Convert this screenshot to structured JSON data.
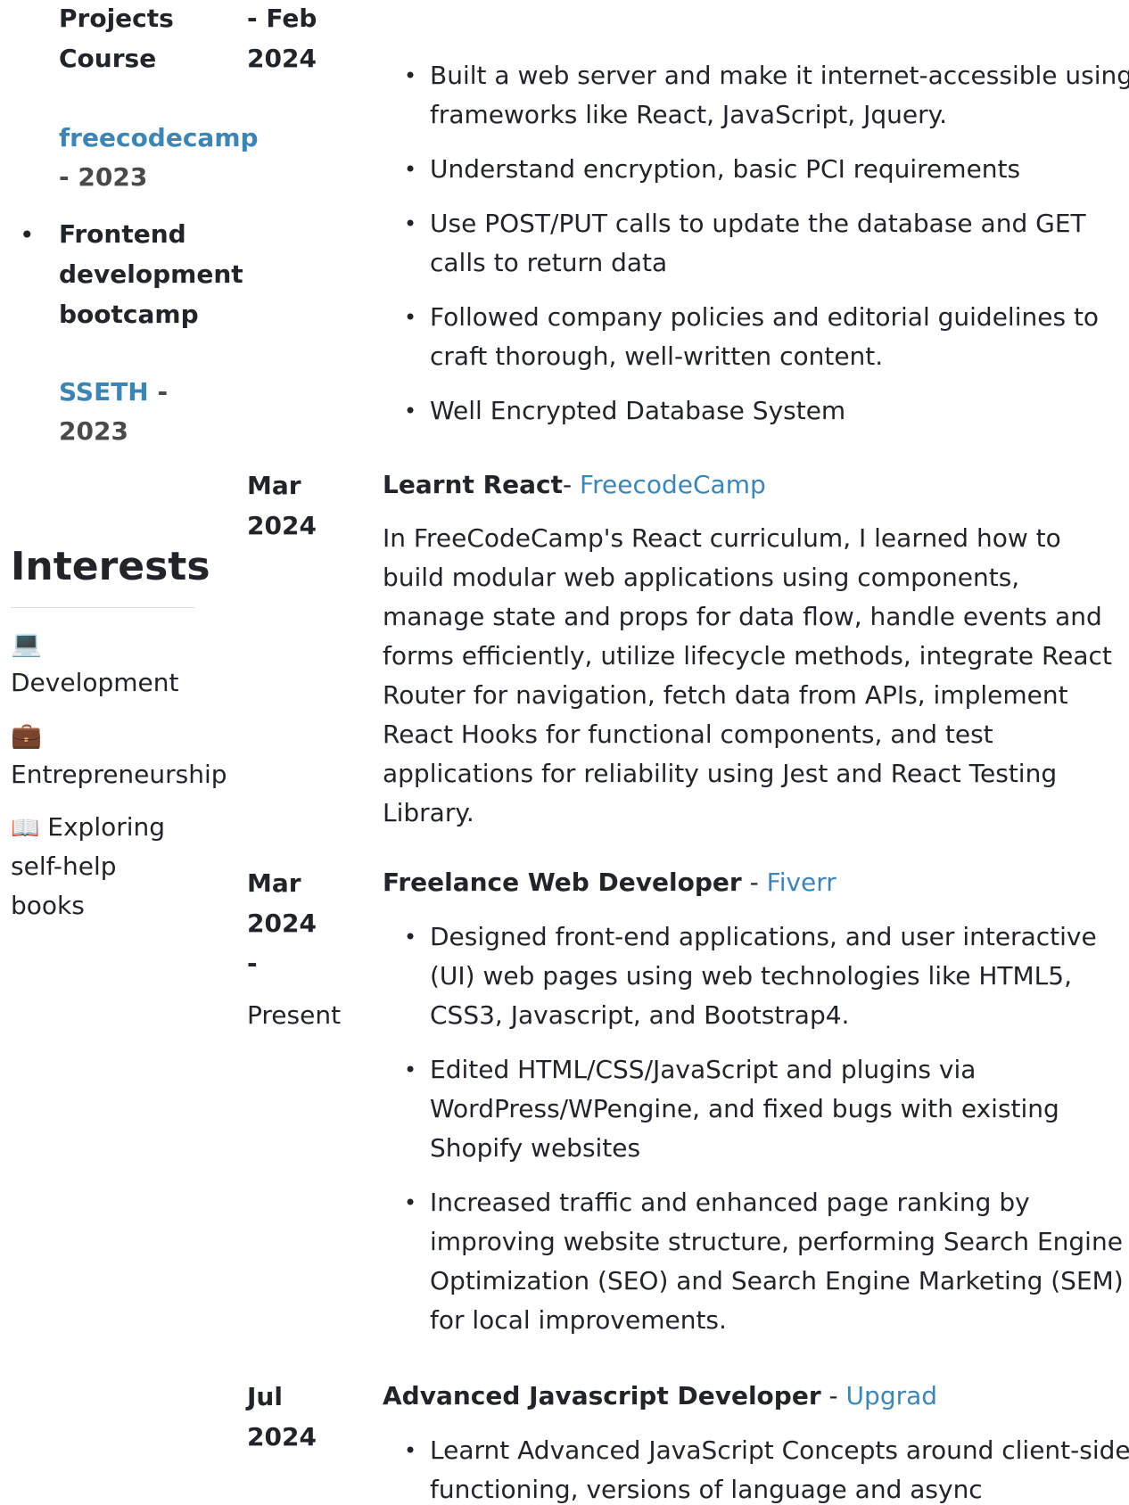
{
  "left": {
    "cert_top": {
      "title_lines": [
        "Projects",
        "Course"
      ]
    },
    "cert_1": {
      "source": "freecodecamp",
      "suffix": "- 2023"
    },
    "cert_2": {
      "title_lines": [
        "Frontend",
        "development",
        "bootcamp"
      ],
      "source": "SSETH",
      "dash": " -",
      "year": "2023"
    },
    "interests": {
      "title": "Interests",
      "items": [
        {
          "emoji": "💻",
          "label": "Development"
        },
        {
          "emoji": "💼",
          "label": "Entrepreneurship"
        },
        {
          "emoji": "📖",
          "label_lines": [
            "Exploring",
            "self-help",
            "books"
          ]
        }
      ]
    }
  },
  "timeline": {
    "top_entry": {
      "date_lines": [
        "- Feb",
        "2024"
      ],
      "bullets": [
        "Built a web server and make it internet-accessible using frameworks like React, JavaScript, Jquery.",
        "Understand encryption, basic PCI requirements",
        "Use POST/PUT calls to update the database and GET calls to return data",
        "Followed company policies and editorial guidelines to craft thorough, well-written content.",
        "Well Encrypted Database System"
      ]
    },
    "react_entry": {
      "date_lines": [
        "Mar",
        "2024"
      ],
      "role": "Learnt React",
      "sep": "- ",
      "org": "FreecodeCamp",
      "paragraph": "In FreeCodeCamp's React curriculum, I learned how to build modular web applications using components, manage state and props for data flow, handle events and forms efficiently, utilize lifecycle methods, integrate React Router for navigation, fetch data from APIs, implement React Hooks for functional components, and test applications for reliability using Jest and React Testing Library."
    },
    "fiverr_entry": {
      "date_lines": [
        "Mar",
        "2024",
        "-"
      ],
      "date_end": "Present",
      "role": "Freelance Web Developer",
      "sep": " - ",
      "org": "Fiverr",
      "bullets": [
        "Designed front-end applications, and user interactive (UI) web pages using web technologies like HTML5, CSS3, Javascript, and Bootstrap4.",
        "Edited HTML/CSS/JavaScript and plugins via WordPress/WPengine, and fixed bugs with existing Shopify websites",
        "Increased traffic and enhanced page ranking by improving website structure, performing Search Engine Optimization (SEO) and Search Engine Marketing (SEM) for local improvements."
      ]
    },
    "upgrad_entry": {
      "date_lines": [
        "Jul",
        "2024"
      ],
      "role": "Advanced Javascript Developer",
      "sep": " - ",
      "org": "Upgrad",
      "bullets": [
        "Learnt Advanced JavaScript Concepts around  client-side functioning, versions of language and async"
      ]
    }
  }
}
